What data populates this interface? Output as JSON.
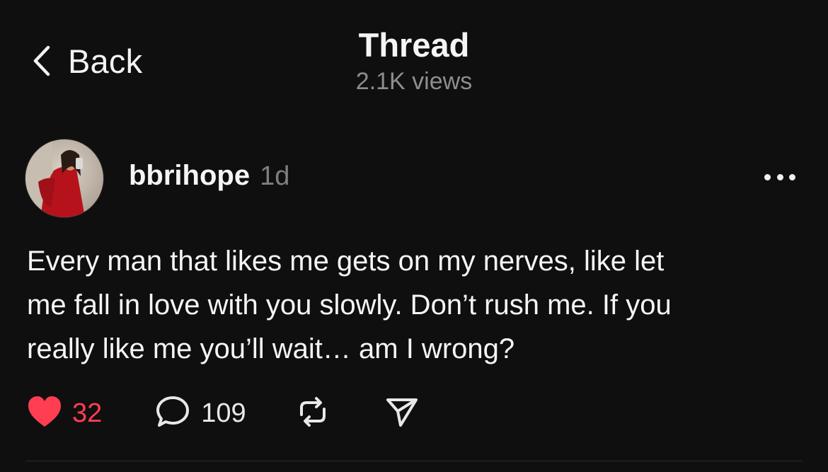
{
  "header": {
    "back_label": "Back",
    "title": "Thread",
    "views": "2.1K views"
  },
  "post": {
    "username": "bbrihope",
    "timestamp": "1d",
    "text": "Every man that likes me gets on my nerves, like let\nme fall in love with you slowly. Don’t rush me. If you\nreally like me you’ll wait… am I wrong?",
    "likes": "32",
    "replies": "109",
    "liked": true
  },
  "icons": {
    "back": "chevron-left-icon",
    "more": "more-horizontal-icon",
    "like": "heart-icon",
    "reply": "speech-bubble-icon",
    "repost": "repost-icon",
    "share": "send-icon"
  },
  "colors": {
    "background": "#0f0f0f",
    "like_active": "#ff3e51",
    "secondary_text": "#8d8d8d"
  }
}
